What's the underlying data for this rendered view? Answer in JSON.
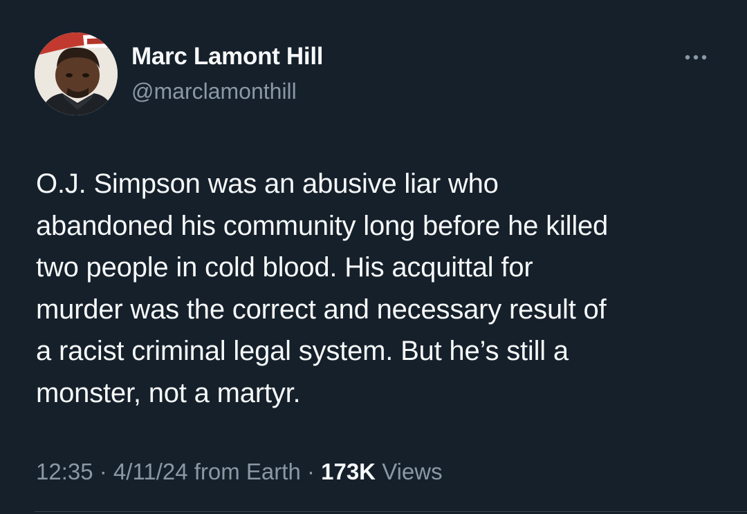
{
  "author": {
    "name": "Marc Lamont Hill",
    "handle": "@marclamonthill"
  },
  "tweet": {
    "text": "O.J. Simpson was an abusive liar who\nabandoned his community long before he killed\ntwo people in cold blood. His acquittal for\nmurder was the correct and necessary result of\na racist criminal legal system. But he’s still a\nmonster, not a martyr."
  },
  "meta": {
    "time": "12:35",
    "separator": " · ",
    "date": "4/11/24",
    "source": "from Earth",
    "views_count": "173K",
    "views_label": "Views"
  },
  "icons": {
    "more": "more-horizontal-icon"
  },
  "colors": {
    "background": "#15202b",
    "primary_text": "#f7f9f9",
    "secondary_text": "#8b98a5"
  }
}
